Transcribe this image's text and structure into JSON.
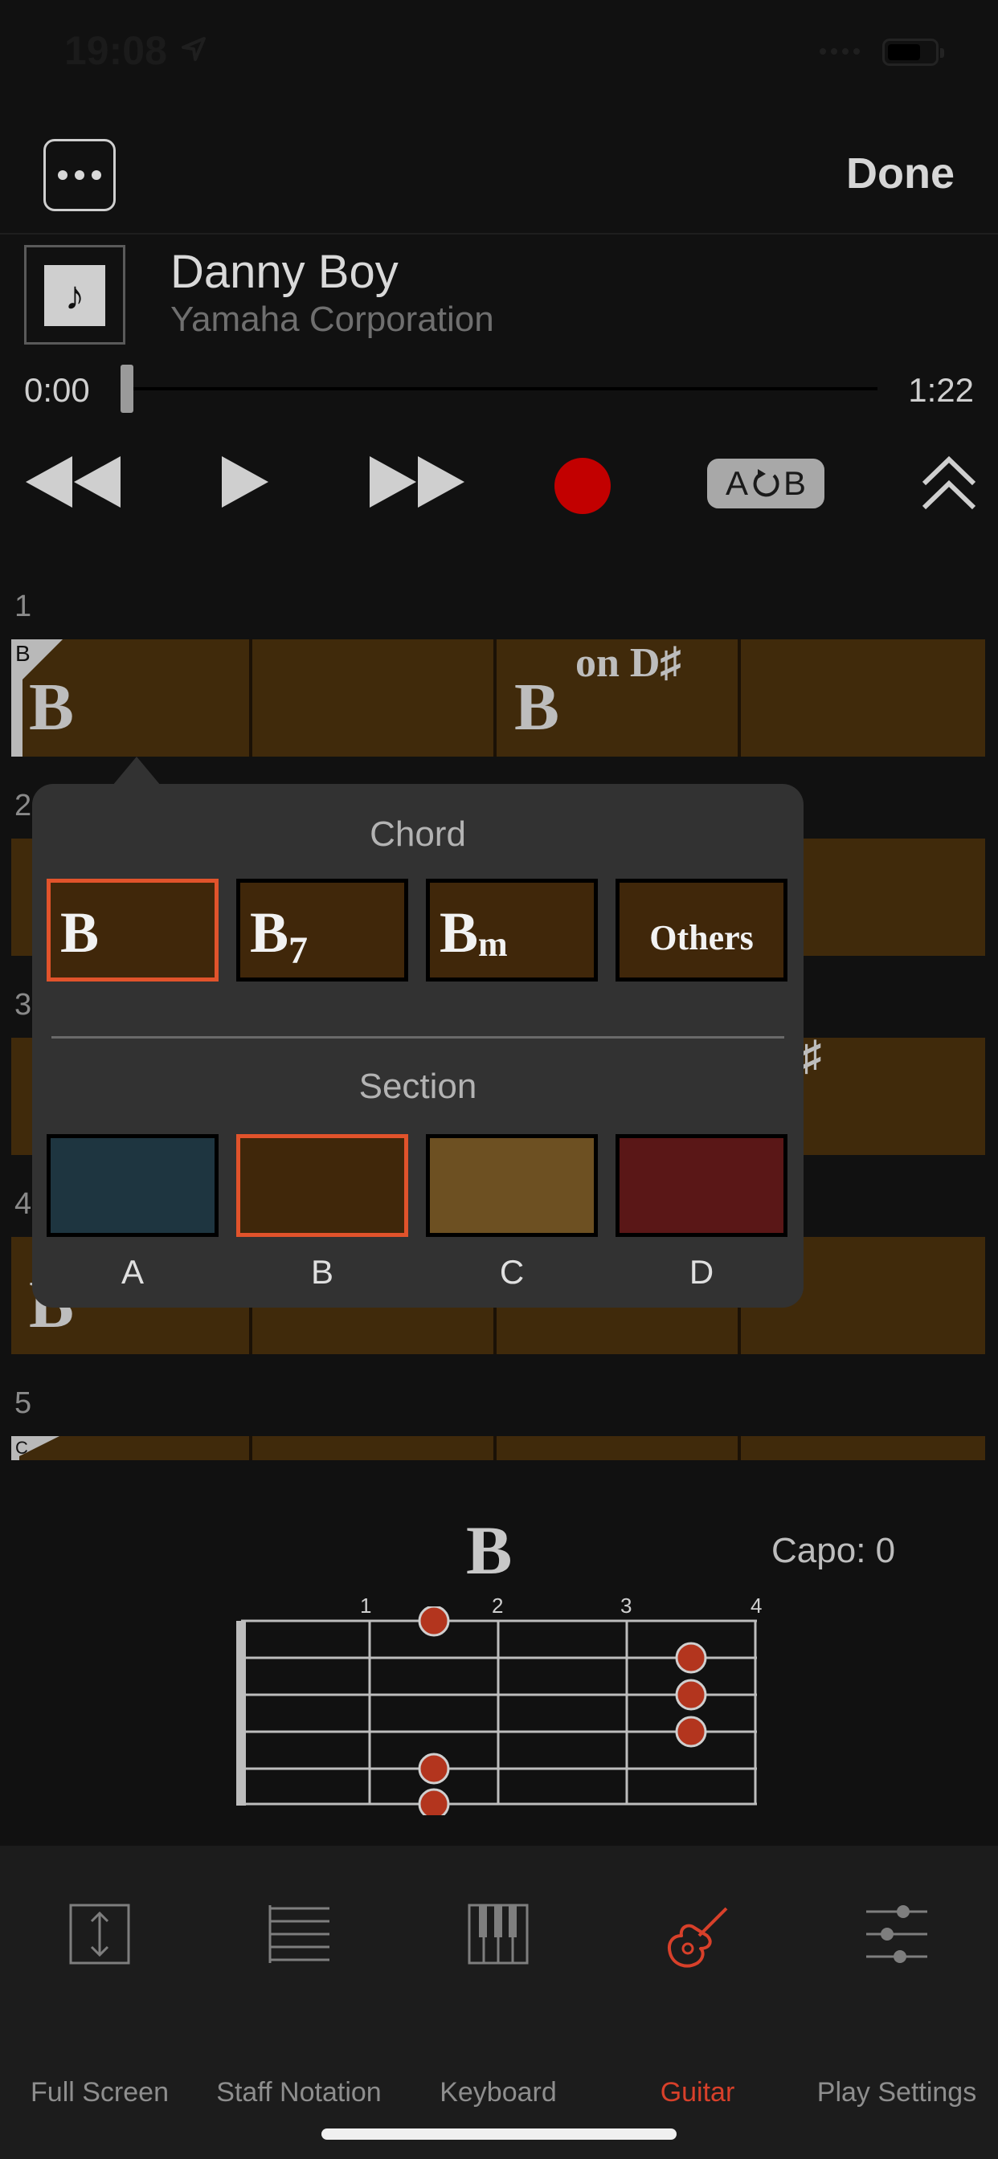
{
  "status": {
    "time": "19:08"
  },
  "nav": {
    "done_label": "Done"
  },
  "song": {
    "title": "Danny Boy",
    "artist": "Yamaha Corporation",
    "time_start": "0:00",
    "time_end": "1:22",
    "progress": 0.0
  },
  "transport": {
    "ab_label_a": "A",
    "ab_label_b": "B"
  },
  "grid": {
    "rows": [
      "1",
      "2",
      "3",
      "4",
      "5"
    ],
    "row1": {
      "section": "B",
      "chord1": "B",
      "chord2": "B",
      "chord2_on": "on D♯"
    },
    "row3_partial": "♯",
    "row4_partial": "B",
    "row5": {
      "section": "C"
    }
  },
  "popover": {
    "chord_heading": "Chord",
    "chords": [
      {
        "label": "B",
        "selected": true
      },
      {
        "label": "B",
        "sub": "7",
        "selected": false
      },
      {
        "label": "B",
        "sub": "m",
        "selected": false
      },
      {
        "label": "Others",
        "selected": false
      }
    ],
    "section_heading": "Section",
    "sections": [
      {
        "label": "A",
        "color": "#1e3540",
        "selected": false
      },
      {
        "label": "B",
        "color": "#40270a",
        "selected": true
      },
      {
        "label": "C",
        "color": "#6d5022",
        "selected": false
      },
      {
        "label": "D",
        "color": "#5a1717",
        "selected": false
      }
    ]
  },
  "chord_diagram": {
    "chord": "B",
    "capo_label": "Capo: 0",
    "fret_numbers": [
      "1",
      "2",
      "3",
      "4"
    ]
  },
  "toolbar": {
    "tabs": [
      {
        "label": "Full Screen",
        "icon": "full-screen-icon"
      },
      {
        "label": "Staff Notation",
        "icon": "staff-notation-icon"
      },
      {
        "label": "Keyboard",
        "icon": "keyboard-icon"
      },
      {
        "label": "Guitar",
        "icon": "guitar-icon",
        "active": true
      },
      {
        "label": "Play Settings",
        "icon": "play-settings-icon"
      }
    ]
  },
  "colors": {
    "accent": "#e1532b",
    "record": "#c20000",
    "active_tab": "#d8402a",
    "bar": "#402a0b"
  }
}
